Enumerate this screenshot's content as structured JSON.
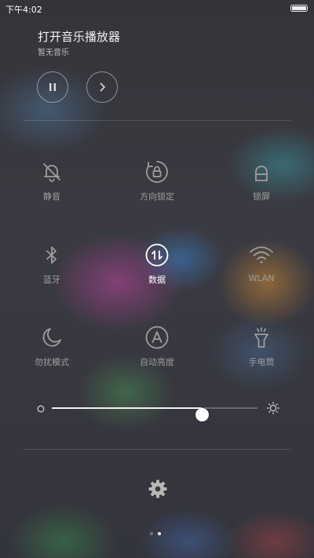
{
  "status_bar": {
    "time": "下午4:02"
  },
  "music": {
    "title": "打开音乐播放器",
    "subtitle": "暂无音乐",
    "pause_icon": "pause-icon",
    "next_icon": "chevron-right-icon"
  },
  "toggles": [
    {
      "label": "静音",
      "icon": "bell-slash-icon",
      "active": false
    },
    {
      "label": "方向锁定",
      "icon": "rotation-lock-icon",
      "active": false
    },
    {
      "label": "锁屏",
      "icon": "lock-icon",
      "active": false
    },
    {
      "label": "蓝牙",
      "icon": "bluetooth-icon",
      "active": false
    },
    {
      "label": "数据",
      "icon": "mobile-data-icon",
      "active": true
    },
    {
      "label": "WLAN",
      "icon": "wifi-icon",
      "active": false
    },
    {
      "label": "勿扰模式",
      "icon": "moon-icon",
      "active": false
    },
    {
      "label": "自动亮度",
      "icon": "auto-brightness-icon",
      "active": false
    },
    {
      "label": "手电筒",
      "icon": "flashlight-icon",
      "active": false
    }
  ],
  "brightness": {
    "level": 0.73,
    "low_icon": "brightness-low-icon",
    "high_icon": "brightness-high-icon"
  },
  "pager": {
    "total": 2,
    "current": 2
  },
  "colors": {
    "active": "#ffffff",
    "inactive": "#9e9e9e",
    "dot_active": "#ffffff",
    "dot_inactive": "#7a7a7a"
  }
}
